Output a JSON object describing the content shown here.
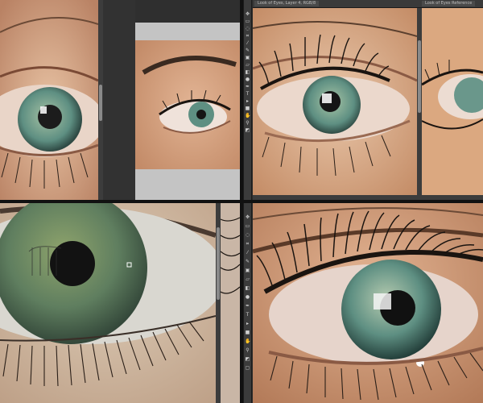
{
  "windows": {
    "top_right": {
      "tabs": [
        "Look of Eyes, Layer 4, RGB/8",
        "Look of Eyes Reference"
      ]
    }
  },
  "tools": {
    "top_right": [
      "move-icon",
      "marquee-icon",
      "lasso-icon",
      "crop-icon",
      "eyedropper-icon",
      "brush-icon",
      "stamp-icon",
      "eraser-icon",
      "gradient-icon",
      "dodge-icon",
      "pen-icon",
      "text-icon",
      "path-icon",
      "shape-icon",
      "hand-icon",
      "zoom-icon",
      "color-swatch-icon"
    ],
    "bottom_right": [
      "move-icon",
      "marquee-icon",
      "lasso-icon",
      "crop-icon",
      "eyedropper-icon",
      "brush-icon",
      "stamp-icon",
      "eraser-icon",
      "gradient-icon",
      "dodge-icon",
      "pen-icon",
      "text-icon",
      "path-icon",
      "shape-icon",
      "hand-icon",
      "zoom-icon",
      "color-swatch-icon",
      "screen-mode-icon"
    ]
  },
  "colors": {
    "skin": "#d9a37c",
    "iris": "#5e8f82",
    "iris_dark": "#3f6b5f",
    "lash": "#1a1410",
    "ui_dark": "#2b2b2b"
  }
}
